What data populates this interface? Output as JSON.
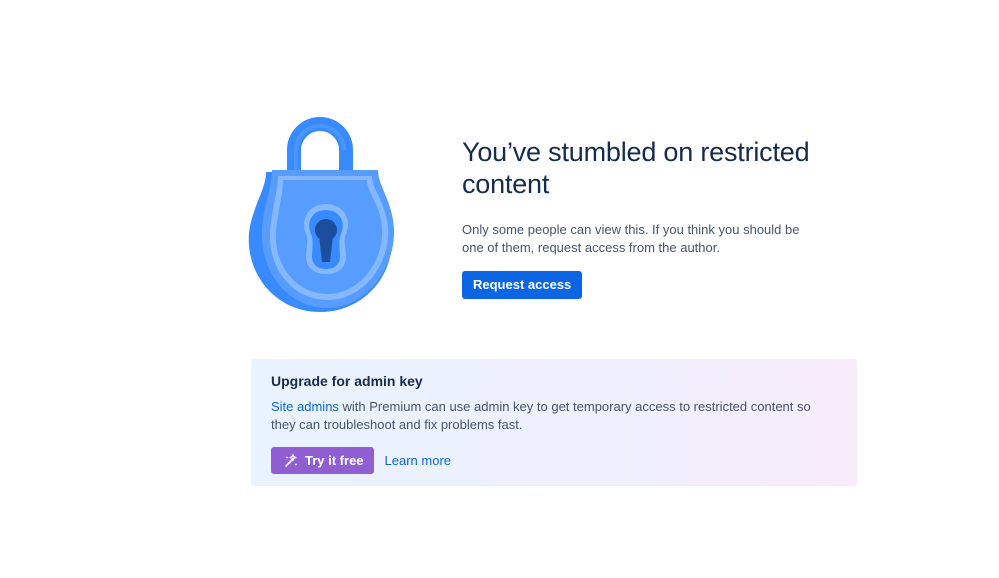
{
  "restricted": {
    "title": "You’ve stumbled on restricted content",
    "description": "Only some people can view this. If you think you should be one of them, request access from the author.",
    "request_button": "Request access"
  },
  "upgrade": {
    "title": "Upgrade for admin key",
    "site_admins_link": "Site admins",
    "text_rest": " with Premium can use admin key to get temporary access to restricted content so they can troubleshoot and fix problems fast.",
    "try_button": "Try it free",
    "learn_more": "Learn more"
  },
  "icons": {
    "illustration": "padlock-icon",
    "try_button_icon": "sparkle-icon"
  },
  "colors": {
    "primary": "#0c66e4",
    "discovery": "#8f5fd1",
    "lock_blue": "#388bff",
    "lock_light": "#85b8ff",
    "text": "#172b4d",
    "subtle_text": "#44546f"
  }
}
